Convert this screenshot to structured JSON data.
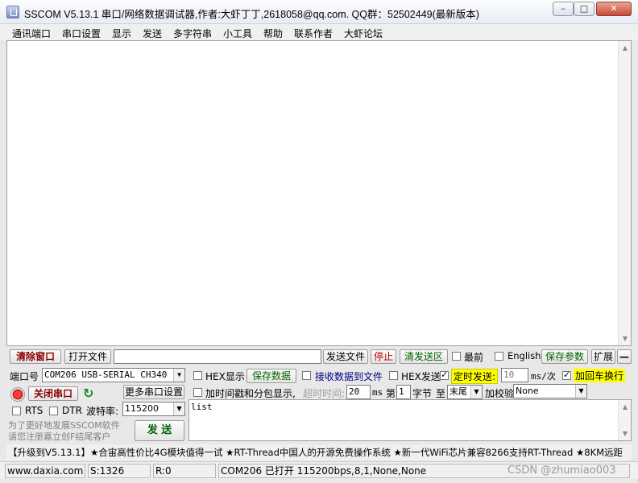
{
  "window": {
    "title": "SSCOM V5.13.1 串口/网络数据调试器,作者:大虾丁丁,2618058@qq.com. QQ群：52502449(最新版本)",
    "min": "–",
    "max": "□",
    "close": "✕"
  },
  "menu": [
    "通讯端口",
    "串口设置",
    "显示",
    "发送",
    "多字符串",
    "小工具",
    "帮助",
    "联系作者",
    "大虾论坛"
  ],
  "toolbar": {
    "clear": "清除窗口",
    "open_file": "打开文件",
    "file_path": "",
    "send_file": "发送文件",
    "stop": "停止",
    "clear_send": "清发送区",
    "topmost": "最前",
    "english": "English",
    "save_params": "保存参数",
    "expand": "扩展",
    "collapse": "—"
  },
  "port": {
    "label": "端口号",
    "value": "COM206 USB-SERIAL CH340",
    "close_btn": "关闭串口",
    "more": "更多串口设置",
    "rts": "RTS",
    "dtr": "DTR",
    "baud_label": "波特率:",
    "baud": "115200"
  },
  "options": {
    "hex_show": "HEX显示",
    "save_data": "保存数据",
    "recv_to_file": "接收数据到文件",
    "hex_send": "HEX发送",
    "timed_send": "定时发送:",
    "interval": "10",
    "interval_unit": "ms/次",
    "add_crlf": "加回车换行",
    "timestamp": "加时间戳和分包显示,",
    "timeout_label": "超时时间:",
    "timeout": "20",
    "ms": "ms",
    "nth": "第",
    "byte_n": "1",
    "byte_label": "字节",
    "to": "至",
    "end": "末尾",
    "checksum_label": "加校验",
    "checksum": "None"
  },
  "promo": {
    "line1": "为了更好地发展SSCOM软件",
    "line2": "请您注册嘉立创F结尾客户",
    "send_btn": "发 送"
  },
  "send_text": "list",
  "marquee": "【升级到V5.13.1】★合宙高性价比4G模块值得一试 ★RT-Thread中国人的开源免费操作系统 ★新一代WiFi芯片兼容8266支持RT-Thread ★8KM远距",
  "status": {
    "site": "www.daxia.com",
    "sent": "S:1326",
    "recv": "R:0",
    "port_state": "COM206 已打开  115200bps,8,1,None,None",
    "watermark": "CSDN @zhumiao003"
  }
}
